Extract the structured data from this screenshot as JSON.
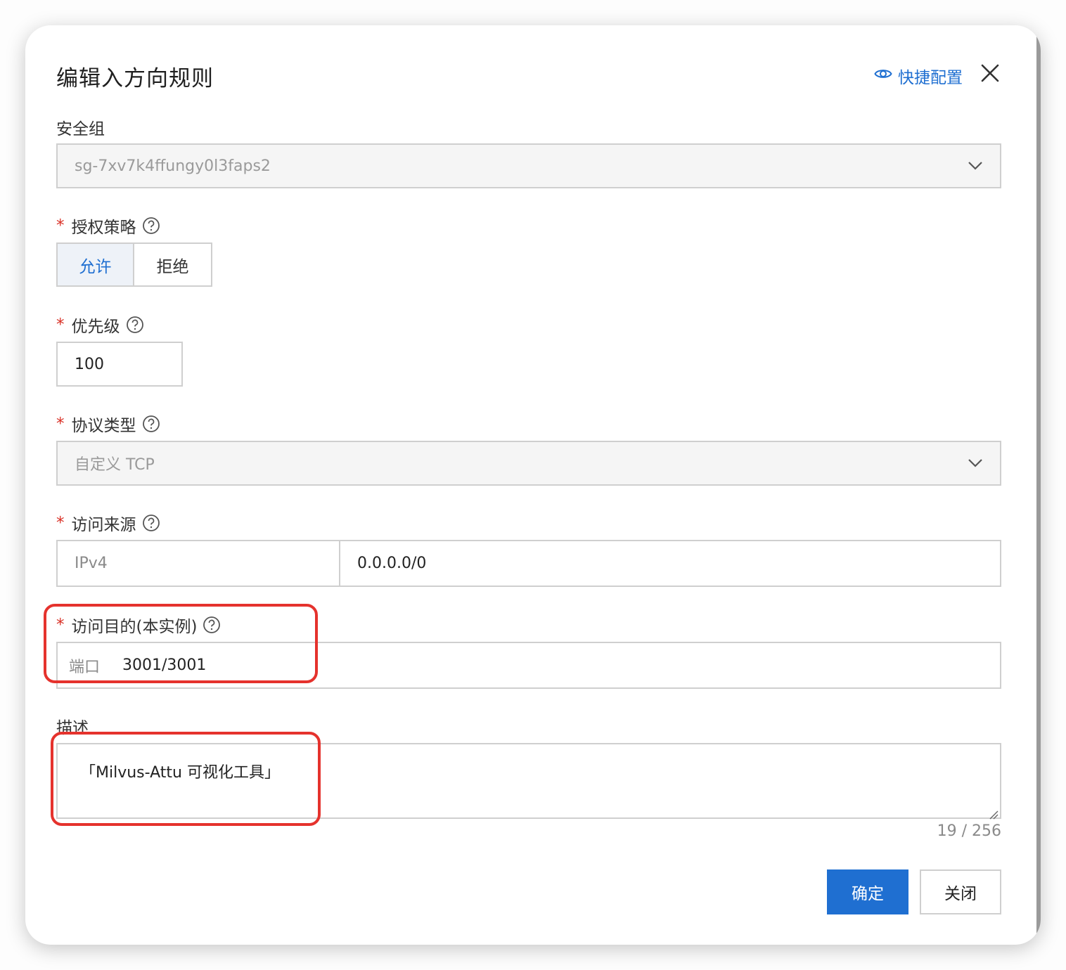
{
  "dialog": {
    "title": "编辑入方向规则",
    "quick_config_label": "快捷配置"
  },
  "security_group": {
    "label": "安全组",
    "value": "sg-7xv7k4ffungy0l3faps2"
  },
  "auth_policy": {
    "label": "授权策略",
    "options": [
      "允许",
      "拒绝"
    ],
    "selected": "允许"
  },
  "priority": {
    "label": "优先级",
    "value": "100"
  },
  "protocol": {
    "label": "协议类型",
    "value": "自定义 TCP"
  },
  "source": {
    "label": "访问来源",
    "type": "IPv4",
    "value": "0.0.0.0/0"
  },
  "destination": {
    "label": "访问目的(本实例)",
    "prefix": "端口",
    "value": "3001/3001"
  },
  "description": {
    "label": "描述",
    "value": "「Milvus-Attu 可视化工具」",
    "counter": "19 / 256"
  },
  "buttons": {
    "confirm": "确定",
    "close": "关闭"
  },
  "colors": {
    "primary": "#1f6fd1",
    "required": "#d93026",
    "annotation": "#e5322d"
  }
}
